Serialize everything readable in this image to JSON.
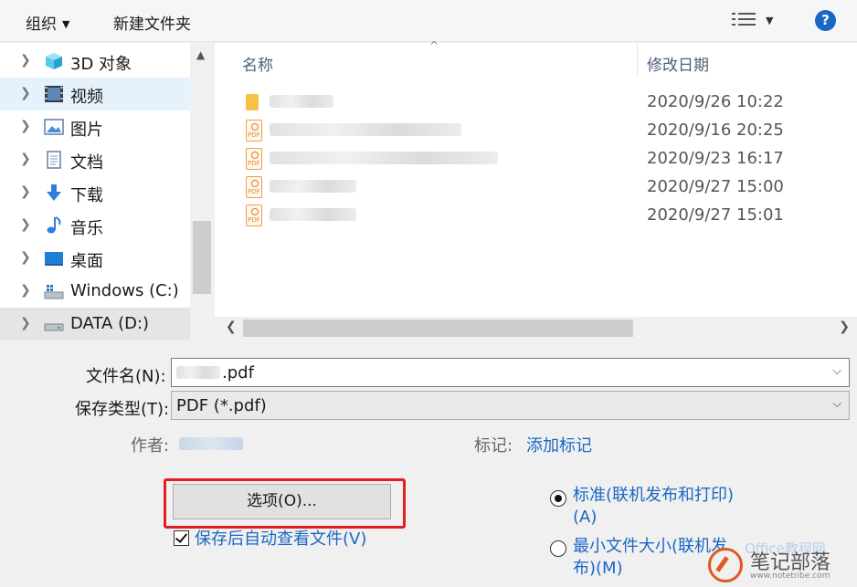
{
  "toolbar": {
    "organize": "组织",
    "new_folder": "新建文件夹",
    "help": "?"
  },
  "nav": {
    "items": [
      {
        "label": "3D 对象",
        "icon": "cube-3d-icon"
      },
      {
        "label": "视频",
        "icon": "video-icon",
        "selected": true
      },
      {
        "label": "图片",
        "icon": "pictures-icon"
      },
      {
        "label": "文档",
        "icon": "documents-icon"
      },
      {
        "label": "下载",
        "icon": "download-arrow-icon"
      },
      {
        "label": "音乐",
        "icon": "music-note-icon"
      },
      {
        "label": "桌面",
        "icon": "desktop-icon"
      },
      {
        "label": "Windows (C:)",
        "icon": "drive-icon"
      },
      {
        "label": "DATA (D:)",
        "icon": "drive-icon",
        "hover": true
      }
    ]
  },
  "files": {
    "col_name": "名称",
    "col_date": "修改日期",
    "rows": [
      {
        "type": "folder",
        "date": "2020/9/26 10:22"
      },
      {
        "type": "pdf",
        "date": "2020/9/16 20:25"
      },
      {
        "type": "pdf",
        "date": "2020/9/23 16:17"
      },
      {
        "type": "pdf",
        "date": "2020/9/27 15:00"
      },
      {
        "type": "pdf",
        "date": "2020/9/27 15:01"
      }
    ]
  },
  "form": {
    "filename_label": "文件名(N):",
    "filename_value": ".pdf",
    "savetype_label": "保存类型(T):",
    "savetype_value": "PDF (*.pdf)",
    "author_label": "作者:",
    "tags_label": "标记:",
    "tags_link": "添加标记",
    "options_button": "选项(O)...",
    "open_after_save": "保存后自动查看文件(V)",
    "radio_standard": "标准(联机发布和打印)(A)",
    "radio_minimum": "最小文件大小(联机发布)(M)"
  },
  "watermark": {
    "text": "笔记部落",
    "sub": "www.notetribe.com",
    "ghost": "Office教程网"
  }
}
